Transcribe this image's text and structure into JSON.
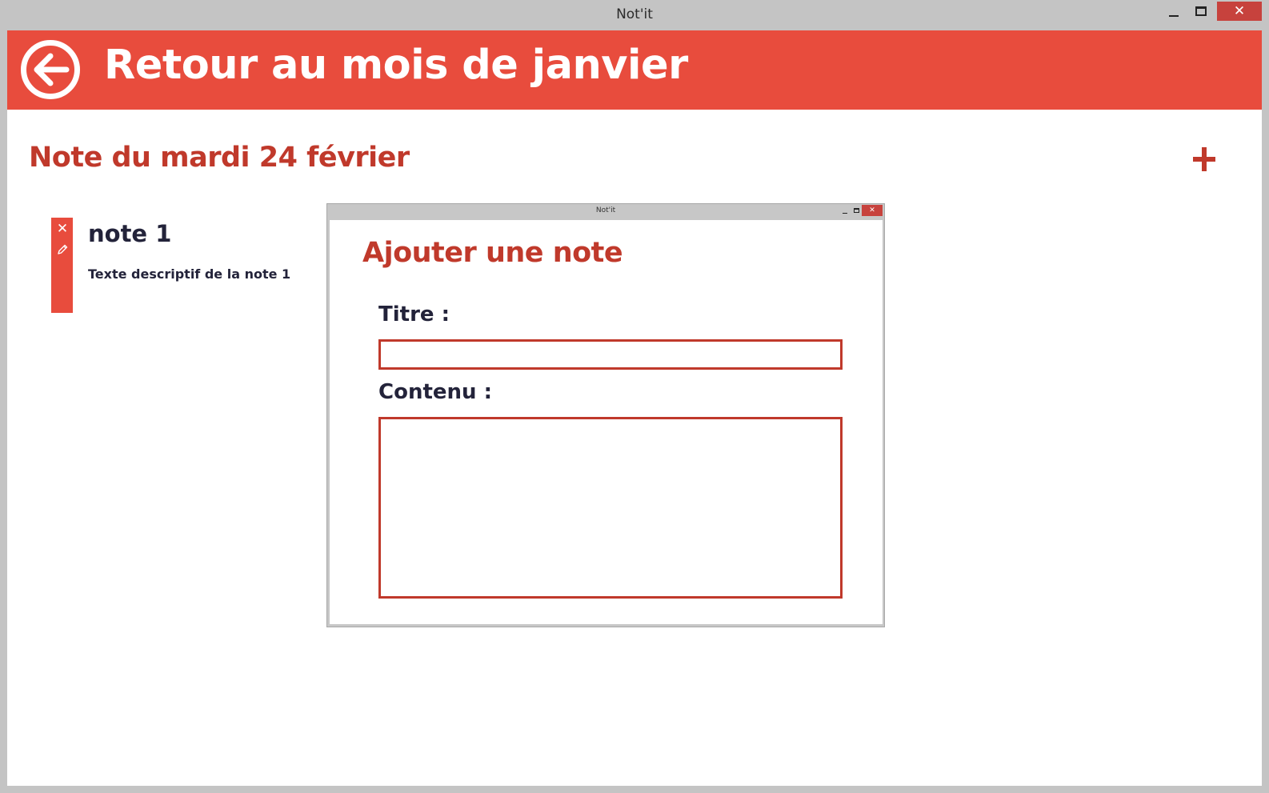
{
  "window": {
    "title": "Not'it",
    "minimize_icon": "minimize-icon",
    "maximize_icon": "maximize-icon",
    "close_label": "✕"
  },
  "header": {
    "back_icon": "back-arrow-icon",
    "title": "Retour au mois de janvier",
    "color": "#e84c3d"
  },
  "page": {
    "title": "Note du mardi 24 février",
    "add_icon": "plus-icon",
    "accent": "#c0392b"
  },
  "notes": [
    {
      "title": "note 1",
      "description": "Texte descriptif de la note 1",
      "delete_icon": "close-icon",
      "edit_icon": "pencil-icon"
    }
  ],
  "dialog": {
    "window_title": "Not'it",
    "close_label": "✕",
    "heading": "Ajouter une note",
    "title_label": "Titre :",
    "title_value": "",
    "content_label": "Contenu :",
    "content_value": ""
  }
}
